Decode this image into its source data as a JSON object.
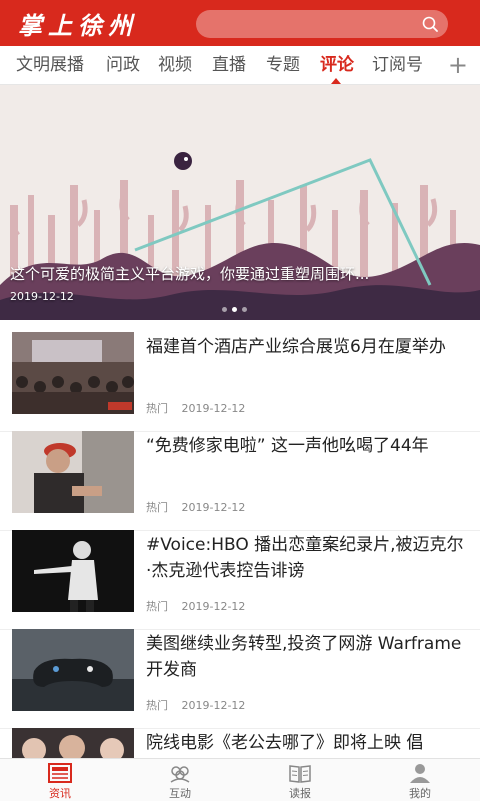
{
  "header": {
    "logo_text": "掌上徐州",
    "search_icon": "search-icon"
  },
  "tabs": {
    "items": [
      {
        "label": "文明展播"
      },
      {
        "label": "问政"
      },
      {
        "label": "视频"
      },
      {
        "label": "直播"
      },
      {
        "label": "专题"
      },
      {
        "label": "评论"
      },
      {
        "label": "订阅号"
      }
    ],
    "active_index": 5,
    "add_label": "+"
  },
  "banner": {
    "caption": "这个可爱的极简主义平台游戏，你要通过重塑周围环...",
    "date": "2019-12-12",
    "slide_count": 3,
    "active_slide": 1
  },
  "news": [
    {
      "title": "福建首个酒店产业综合展览6月在厦举办",
      "tag": "热门",
      "date": "2019-12-12"
    },
    {
      "title": "“免费修家电啦” 这一声他吆喝了44年",
      "tag": "热门",
      "date": "2019-12-12"
    },
    {
      "title": "#Voice:HBO 播出恋童案纪录片,被迈克尔·杰克逊代表控告诽谤",
      "tag": "热门",
      "date": "2019-12-12"
    },
    {
      "title": "美图继续业务转型,投资了网游 Warframe 开发商",
      "tag": "热门",
      "date": "2019-12-12"
    },
    {
      "title": "院线电影《老公去哪了》即将上映 倡",
      "tag": "",
      "date": ""
    }
  ],
  "bottom_nav": {
    "items": [
      {
        "label": "资讯",
        "icon": "news-icon"
      },
      {
        "label": "互动",
        "icon": "community-icon"
      },
      {
        "label": "读报",
        "icon": "book-icon"
      },
      {
        "label": "我的",
        "icon": "user-icon"
      }
    ],
    "active_index": 0
  },
  "colors": {
    "brand_red": "#d8291d",
    "inactive_text": "#555555"
  }
}
